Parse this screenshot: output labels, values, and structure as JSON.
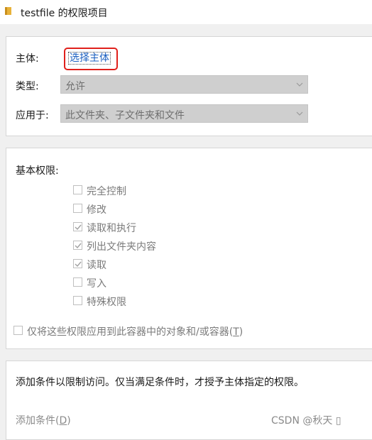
{
  "window": {
    "title": "testfile 的权限项目",
    "folder_icon": "folder-icon"
  },
  "principal": {
    "label": "主体:",
    "link_text": "选择主体",
    "highlight_color": "#e0201b"
  },
  "type": {
    "label": "类型:",
    "value": "允许"
  },
  "applies_to": {
    "label": "应用于:",
    "value": "此文件夹、子文件夹和文件"
  },
  "basic_permissions": {
    "heading": "基本权限:",
    "items": [
      {
        "label": "完全控制",
        "checked": false
      },
      {
        "label": "修改",
        "checked": false
      },
      {
        "label": "读取和执行",
        "checked": true
      },
      {
        "label": "列出文件夹内容",
        "checked": true
      },
      {
        "label": "读取",
        "checked": true
      },
      {
        "label": "写入",
        "checked": false
      },
      {
        "label": "特殊权限",
        "checked": false
      }
    ]
  },
  "apply_only": {
    "label": "仅将这些权限应用到此容器中的对象和/或容器(",
    "accelerator": "T",
    "suffix": ")",
    "checked": false
  },
  "conditions": {
    "text": "添加条件以限制访问。仅当满足条件时，才授予主体指定的权限。",
    "add_link": "添加条件(",
    "add_accelerator": "D",
    "add_suffix": ")"
  },
  "watermark": "CSDN @秋天 ▯",
  "colors": {
    "link": "#1b5fc0",
    "disabled_text": "#7a7a7a",
    "combo_bg": "#cfcfcf"
  }
}
